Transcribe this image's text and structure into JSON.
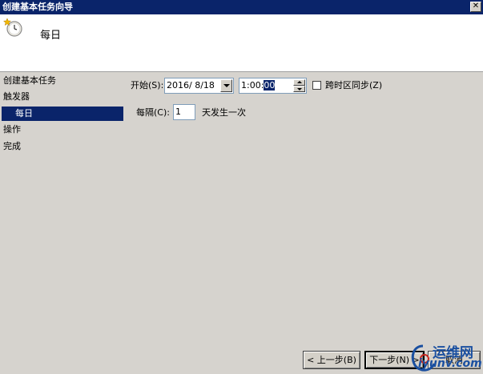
{
  "window": {
    "title": "创建基本任务向导",
    "close_glyph": "✕"
  },
  "header": {
    "title": "每日",
    "icon": "clock-star-icon"
  },
  "sidebar": {
    "items": [
      {
        "label": "创建基本任务"
      },
      {
        "label": "触发器"
      },
      {
        "label": "每日",
        "selected": true
      },
      {
        "label": "操作"
      },
      {
        "label": "完成"
      }
    ]
  },
  "form": {
    "start_label": "开始(S):",
    "start_date": "2016/  8/18",
    "start_time_prefix": "1:00:",
    "start_time_selected": "00",
    "sync_timezone_label": "跨时区同步(Z)",
    "sync_timezone_checked": false,
    "recur_label": "每隔(C):",
    "recur_value": "1",
    "recur_suffix": "天发生一次"
  },
  "buttons": {
    "back": "< 上一步(B)",
    "next": "下一步(N) >",
    "cancel": "取消"
  },
  "watermark": {
    "line1": "运维网",
    "line2": "iyunv.com"
  },
  "colors": {
    "title_bar": "#0a246a",
    "selection": "#0a246a",
    "dialog_bg": "#d6d3ce",
    "watermark": "#1a4fa0"
  }
}
